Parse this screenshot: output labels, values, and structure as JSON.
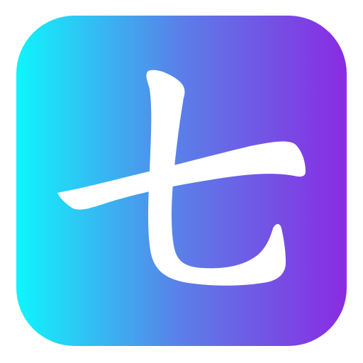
{
  "app_icon": {
    "glyph": "七",
    "glyph_color": "#ffffff",
    "gradient": {
      "direction": "left-to-right",
      "start_color": "#0ff5fc",
      "mid_color": "#5b7ee8",
      "end_color": "#8a2be2"
    },
    "icon_name": "seven-kanji-icon"
  }
}
